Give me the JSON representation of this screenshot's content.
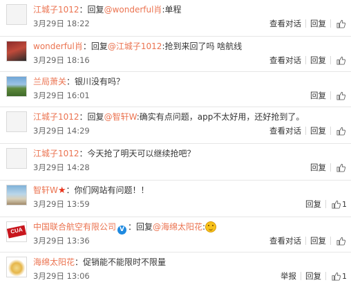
{
  "comments": [
    {
      "user": "江城子1012",
      "prefix": "：回复",
      "mention": "@wonderful肖",
      "text": ":单程",
      "time": "3月29日 18:22",
      "actions": [
        "查看对话",
        "回复"
      ],
      "like_count": "",
      "avatar": "blank"
    },
    {
      "user": "wonderful肖",
      "prefix": "：回复",
      "mention": "@江城子1012",
      "text": ":抢到来回了吗 啥航线",
      "time": "3月29日 18:16",
      "actions": [
        "查看对话",
        "回复"
      ],
      "like_count": "",
      "avatar": "photo-red"
    },
    {
      "user": "兰局萧关",
      "prefix": "：银川没有吗？",
      "mention": "",
      "text": "",
      "time": "3月29日 16:01",
      "actions": [
        "回复"
      ],
      "like_count": "",
      "avatar": "photo-landscape"
    },
    {
      "user": "江城子1012",
      "prefix": "：回复",
      "mention": "@智轩W",
      "text": ":确实有点问题，app不太好用，还好抢到了。",
      "time": "3月29日 14:29",
      "actions": [
        "查看对话",
        "回复"
      ],
      "like_count": "",
      "avatar": "blank"
    },
    {
      "user": "江城子1012",
      "prefix": "：今天抢了明天可以继续抢吧？",
      "mention": "",
      "text": "",
      "time": "3月29日 14:28",
      "actions": [
        "回复"
      ],
      "like_count": "",
      "avatar": "blank"
    },
    {
      "user": "智轩W",
      "prefix": "：你们网站有问题！！",
      "mention": "",
      "text": "",
      "time": "3月29日 13:59",
      "actions": [
        "回复"
      ],
      "like_count": "1",
      "avatar": "photo-sea",
      "star": "★"
    },
    {
      "user": "中国联合航空有限公司",
      "prefix": "：回复",
      "mention": "@海绵太阳花",
      "text": ":",
      "time": "3月29日 13:36",
      "actions": [
        "查看对话",
        "回复"
      ],
      "like_count": "",
      "avatar": "logo-cua",
      "verified": "V",
      "avatar_text": "CUA"
    },
    {
      "user": "海绵太阳花",
      "prefix": "：促销能不能限时不限量",
      "mention": "",
      "text": "",
      "time": "3月29日 13:06",
      "actions": [
        "举报",
        "回复"
      ],
      "like_count": "1",
      "avatar": "photo-cartoon"
    }
  ],
  "icons": {
    "like": "thumbs-up-icon",
    "star": "red-star-icon",
    "verified": "verified-badge-icon",
    "emoji": "thinking-emoji-icon"
  },
  "colors": {
    "username": "#eb7350",
    "verified": "#1f8ae0",
    "divider": "#e6e6e6"
  }
}
